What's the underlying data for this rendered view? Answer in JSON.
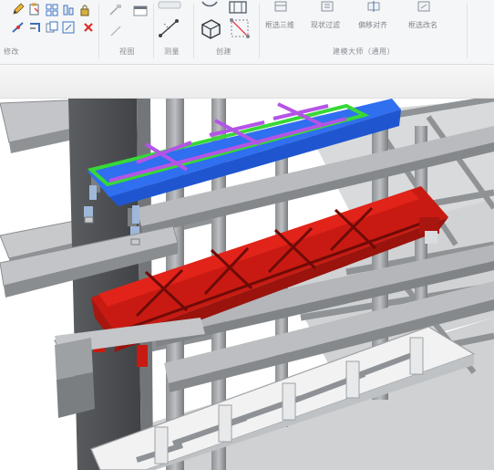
{
  "ribbon": {
    "panels": {
      "modify": {
        "label": "修改"
      },
      "view": {
        "label": "视图"
      },
      "measure": {
        "label": "测量"
      },
      "create": {
        "label": "创建"
      },
      "model": {
        "label": "建模大师（通用）"
      }
    },
    "tools": {
      "filter_3d": "框选三维",
      "quick_filter": "现状过滤",
      "bias_align": "偏移对齐",
      "rename": "框选改名"
    }
  },
  "colors": {
    "selected_truss_fill": "#c81a12",
    "selected_truss_highlight": "#e2231a",
    "preview_truss_fill": "#2f6ff0",
    "preview_truss_member": "#b454e6",
    "preview_outline": "#37d837",
    "concrete_light": "#d4d6d8",
    "concrete_mid": "#a8abae",
    "concrete_dark": "#6f7275",
    "core_wall": "#4d4f52",
    "glass_frame": "#f2f2f2"
  },
  "icons": [
    "pencil-icon",
    "paste-icon",
    "array-icon",
    "align-icon",
    "split-icon",
    "trim-icon",
    "delete-icon",
    "hide-icon",
    "dimension-icon",
    "component-icon",
    "box-icon",
    "filter-3d-icon",
    "quick-filter-icon",
    "bias-align-icon",
    "rename-icon"
  ]
}
